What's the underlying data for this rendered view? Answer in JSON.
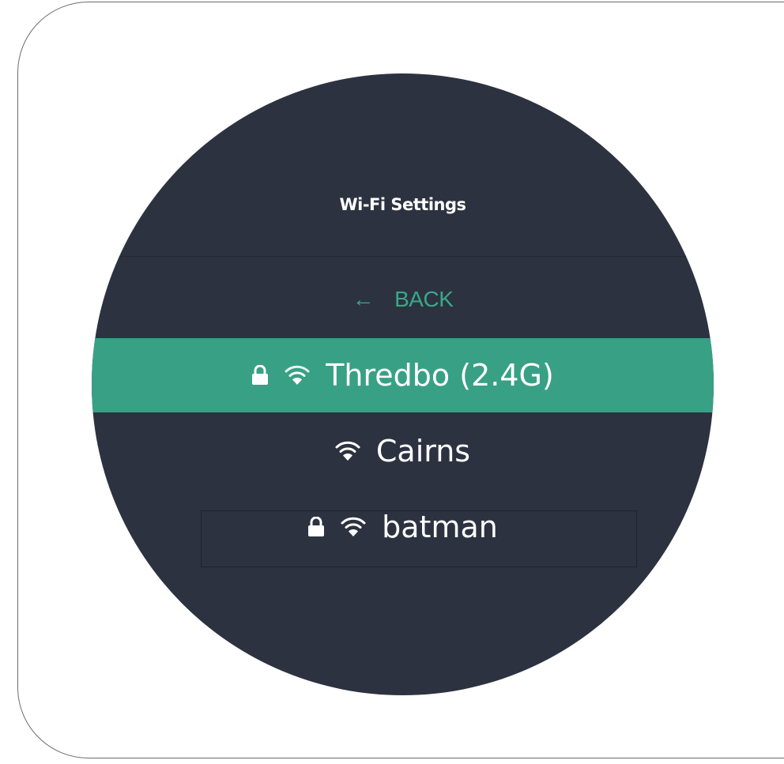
{
  "screen": {
    "title": "Wi-Fi Settings",
    "back": {
      "arrow": "←",
      "label": "BACK"
    },
    "networks": [
      {
        "name": "Thredbo (2.4G)",
        "secured": true,
        "selected": true,
        "icon": "wifi-icon"
      },
      {
        "name": "Cairns",
        "secured": false,
        "selected": false,
        "icon": "wifi-icon"
      },
      {
        "name": "batman",
        "secured": true,
        "selected": false,
        "icon": "wifi-icon"
      }
    ]
  },
  "colors": {
    "background": "#ffffff",
    "device": "#2d3240",
    "accent": "#38a085",
    "back_text": "#39a888",
    "text": "#ffffff"
  }
}
